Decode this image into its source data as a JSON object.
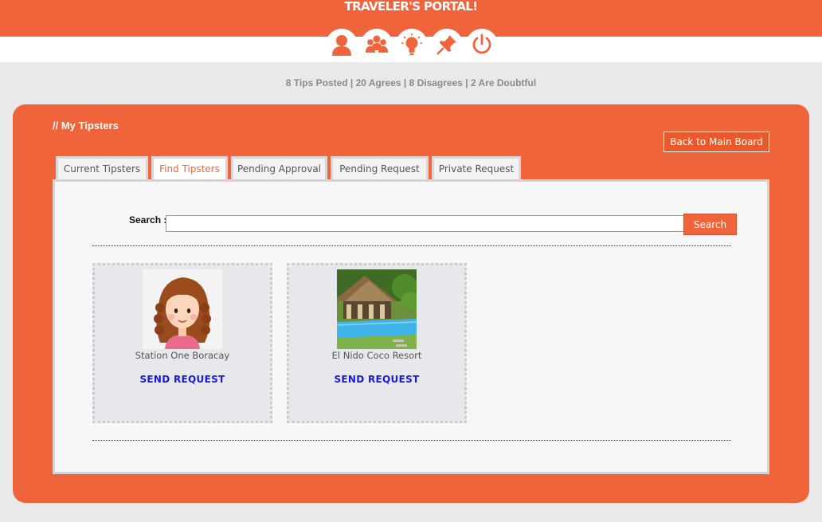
{
  "header": {
    "title": "TRAVELER'S PORTAL!",
    "nav_icons": [
      "profile-icon",
      "group-icon",
      "lightbulb-icon",
      "pin-icon",
      "power-icon"
    ]
  },
  "stats": "8 Tips Posted | 20 Agrees | 8 Disagrees | 2 Are Doubtful",
  "section": {
    "title": "// My Tipsters",
    "back_button": "Back to Main Board"
  },
  "tabs": [
    {
      "label": "Current Tipsters",
      "active": false
    },
    {
      "label": "Find Tipsters",
      "active": true
    },
    {
      "label": "Pending Approval",
      "active": false
    },
    {
      "label": "Pending Request",
      "active": false
    },
    {
      "label": "Private Request",
      "active": false
    }
  ],
  "search": {
    "label": "Search :",
    "value": "",
    "placeholder": "",
    "button": "Search"
  },
  "results": [
    {
      "name": "Station One Boracay",
      "action": "SEND REQUEST",
      "image": "girl-avatar"
    },
    {
      "name": "El Nido Coco Resort",
      "action": "SEND REQUEST",
      "image": "resort-photo"
    }
  ],
  "colors": {
    "brand": "#f0643c",
    "link": "#1a1ad6",
    "background": "#e9e9e9"
  }
}
